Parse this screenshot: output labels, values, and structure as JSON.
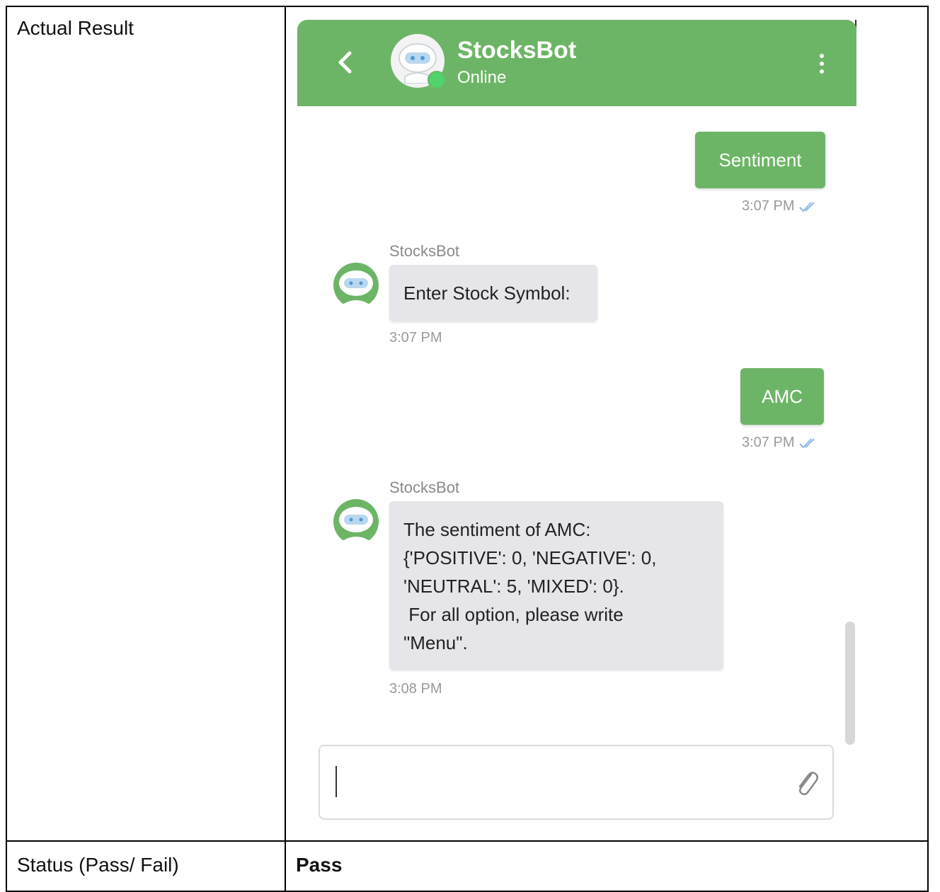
{
  "table": {
    "actual_result_label": "Actual Result",
    "status_label": "Status (Pass/ Fail)",
    "status_value": "Pass"
  },
  "chat": {
    "header": {
      "title": "StocksBot",
      "status": "Online"
    },
    "messages": [
      {
        "direction": "outgoing",
        "text": "Sentiment",
        "time": "3:07 PM"
      },
      {
        "direction": "incoming",
        "sender": "StocksBot",
        "lines": [
          "Enter Stock Symbol:"
        ],
        "time": "3:07 PM"
      },
      {
        "direction": "outgoing",
        "text": "AMC",
        "time": "3:07 PM"
      },
      {
        "direction": "incoming",
        "sender": "StocksBot",
        "lines": [
          "The sentiment of AMC:",
          "{'POSITIVE': 0, 'NEGATIVE': 0,",
          "'NEUTRAL': 5, 'MIXED': 0}.",
          " For all option, please write",
          "\"Menu\"."
        ],
        "time": "3:08 PM"
      }
    ],
    "input": {
      "value": ""
    },
    "icons": {
      "back": "chevron-left-icon",
      "menu": "kebab-menu-icon",
      "read_receipt": "double-check-icon",
      "attach": "paperclip-icon"
    },
    "colors": {
      "header": "#6db566",
      "outgoing_bubble": "#6db566",
      "incoming_bubble": "#e6e6ea",
      "online": "#4fd36a",
      "read_receipt": "#8fb8e8"
    }
  }
}
